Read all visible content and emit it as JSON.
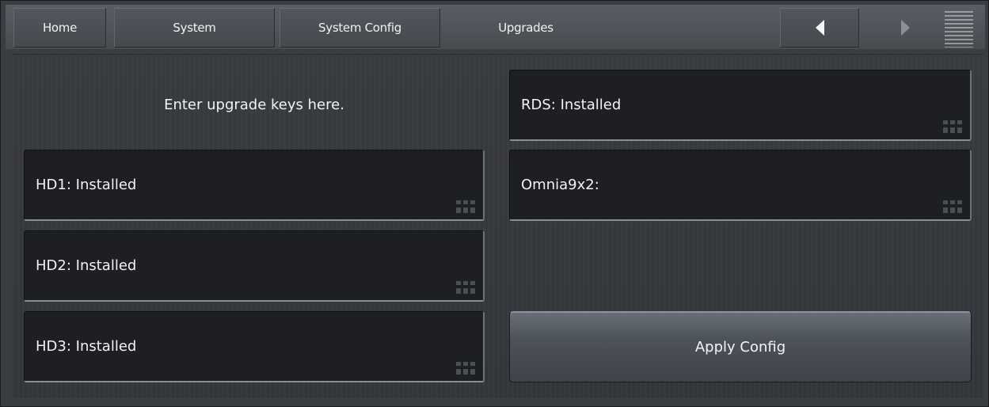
{
  "nav": {
    "home": "Home",
    "system": "System",
    "system_config": "System Config",
    "current": "Upgrades"
  },
  "icons": {
    "back": "triangle-left-arrow",
    "forward": "triangle-right-arrow",
    "menu": "hamburger-menu"
  },
  "info_text": "Enter upgrade keys here.",
  "fields": {
    "hd1": "HD1: Installed",
    "hd2": "HD2: Installed",
    "hd3": "HD3: Installed",
    "rds": "RDS: Installed",
    "omnia": "Omnia9x2:"
  },
  "apply_label": "Apply Config",
  "colors": {
    "background": "#3a3d42",
    "field": "#1d1f23",
    "text": "#f2f2f2"
  }
}
